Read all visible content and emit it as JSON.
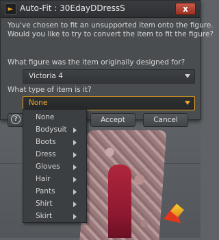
{
  "dialog": {
    "title": "Auto-Fit : 30EdayDDressS",
    "close_label": "x",
    "message_line1": "You've chosen to fit an unsupported item onto the figure.",
    "message_line2": "Would you like to try to convert the item to fit the figure?",
    "question_figure": "What figure was the item originally designed for?",
    "figure_selected": "Victoria 4",
    "question_type": "What type of item is it?",
    "type_selected": "None",
    "help_label": "?",
    "accept_label": "Accept",
    "cancel_label": "Cancel"
  },
  "menu": {
    "items": [
      {
        "label": "None",
        "has_submenu": false
      },
      {
        "label": "Bodysuit",
        "has_submenu": true
      },
      {
        "label": "Boots",
        "has_submenu": true
      },
      {
        "label": "Dress",
        "has_submenu": true
      },
      {
        "label": "Gloves",
        "has_submenu": true
      },
      {
        "label": "Hair",
        "has_submenu": true
      },
      {
        "label": "Pants",
        "has_submenu": true
      },
      {
        "label": "Shirt",
        "has_submenu": true
      },
      {
        "label": "Skirt",
        "has_submenu": true
      }
    ]
  },
  "icons": {
    "app": "daz-logo-icon",
    "help": "help-icon",
    "submenu": "chevron-right-icon",
    "dropdown": "chevron-down-icon"
  },
  "colors": {
    "accent": "#f0a828",
    "dialog_bg": "#4a4d50",
    "close_red": "#c85a4a"
  }
}
